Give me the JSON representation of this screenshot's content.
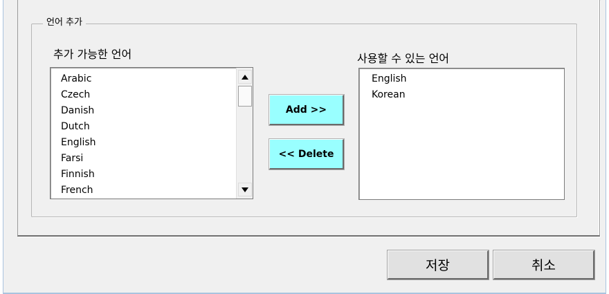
{
  "group": {
    "legend": "언어 추가"
  },
  "available": {
    "label": "추가 가능한 언어",
    "items": [
      "Arabic",
      "Czech",
      "Danish",
      "Dutch",
      "English",
      "Farsi",
      "Finnish",
      "French"
    ]
  },
  "usable": {
    "label": "사용할 수 있는 언어",
    "items": [
      "English",
      "Korean"
    ]
  },
  "buttons": {
    "add": "Add >>",
    "delete": "<< Delete",
    "save": "저장",
    "cancel": "취소"
  },
  "icons": {
    "scroll_up": "arrow-up-icon",
    "scroll_down": "arrow-down-icon"
  },
  "colors": {
    "action_button": "#99ffff",
    "dialog_bg": "#f0f0f0"
  }
}
